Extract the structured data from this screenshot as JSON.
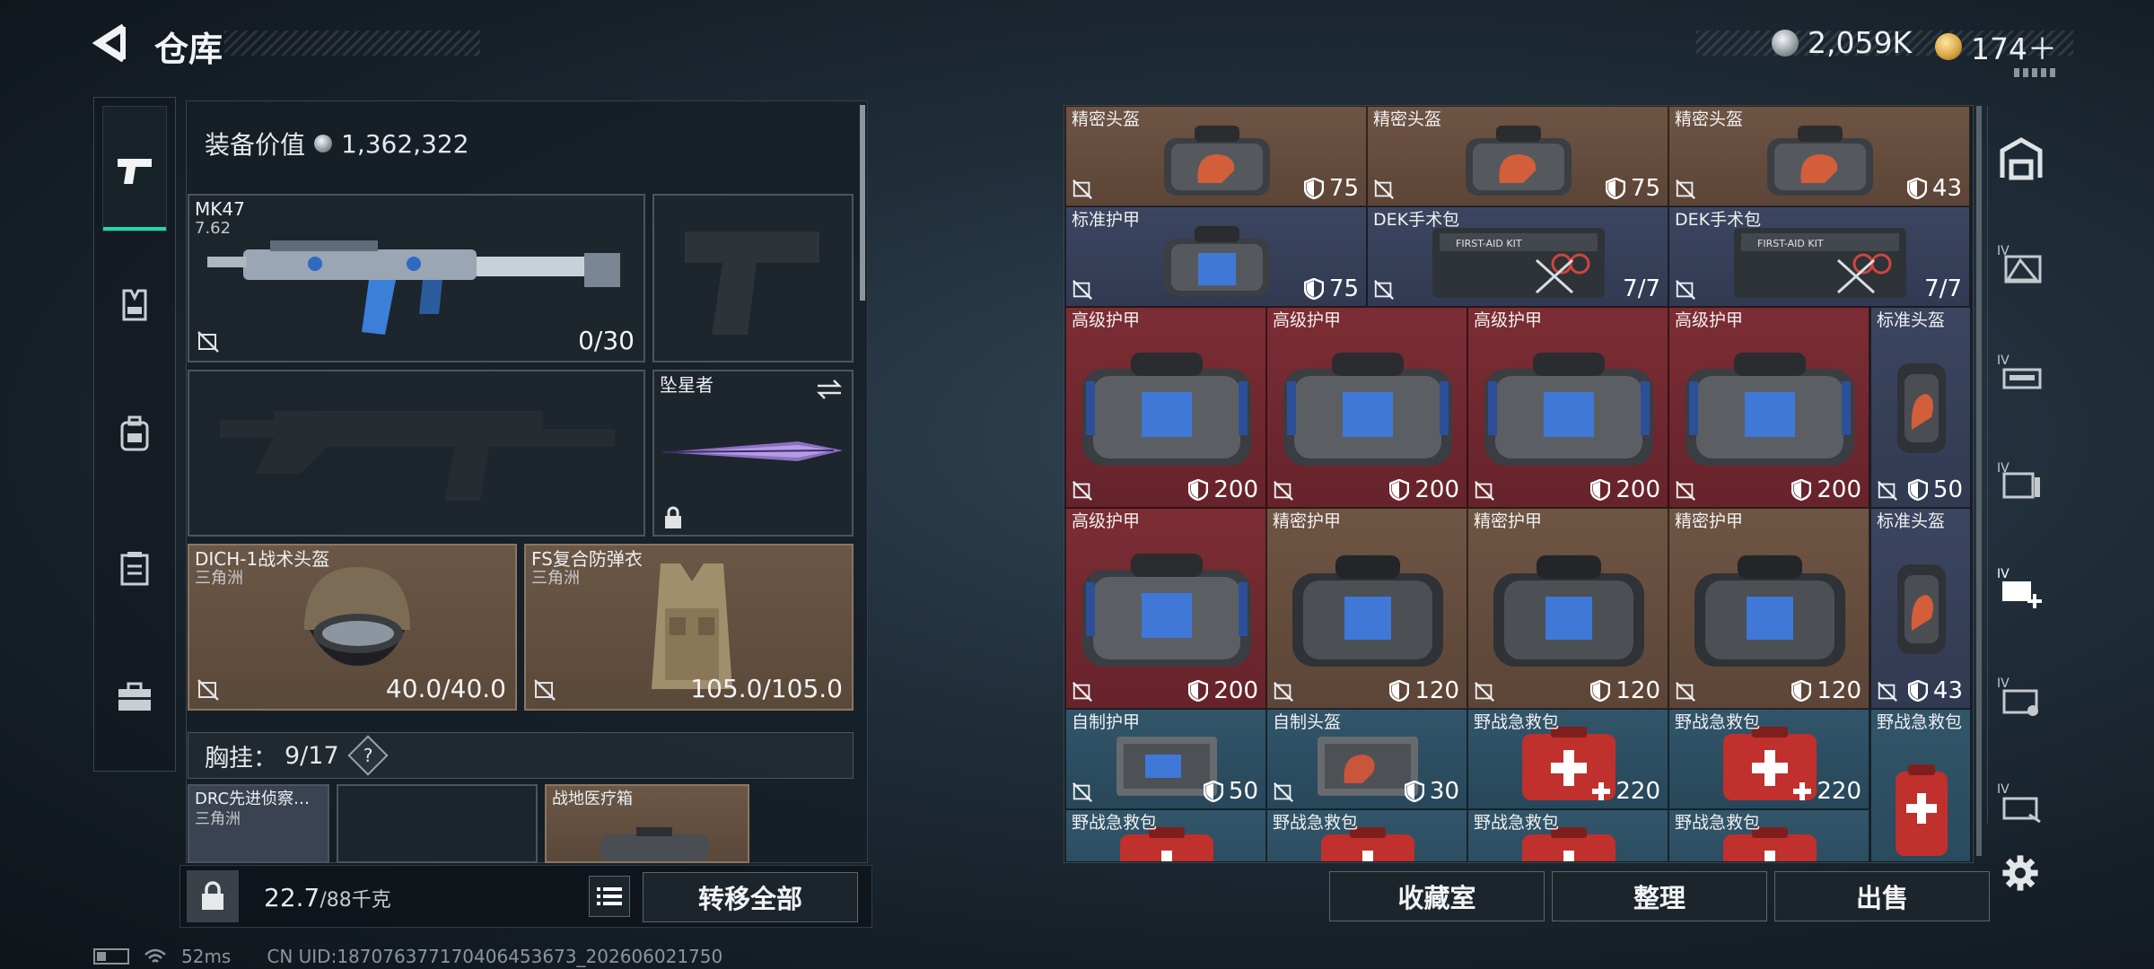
{
  "header": {
    "title": "仓库",
    "currency1": "2,059K",
    "currency2": "174＋"
  },
  "left": {
    "equip_value_label": "装备价值",
    "equip_value": "1,362,322",
    "weapon1": {
      "name": "MK47",
      "ammo_type": "7.62",
      "ammo": "0/30"
    },
    "melee": {
      "name": "坠星者"
    },
    "helmet": {
      "name": "DICH-1战术头盔",
      "origin": "三角洲",
      "durability": "40.0/40.0"
    },
    "armor": {
      "name": "FS复合防弹衣",
      "origin": "三角洲",
      "durability": "105.0/105.0"
    },
    "rig": {
      "label": "胸挂：",
      "capacity": "9/17",
      "help": "?"
    },
    "rig_items": [
      {
        "name": "DRC先进侦察…",
        "origin": "三角洲"
      },
      {
        "name": ""
      },
      {
        "name": "战地医疗箱"
      }
    ],
    "weight": "22.7",
    "weight_max": "/88千克",
    "transfer_all": "转移全部"
  },
  "grid": {
    "cells": [
      {
        "name": "精密头盔",
        "value": "75",
        "kind": "shield",
        "color": "brown"
      },
      {
        "name": "精密头盔",
        "value": "75",
        "kind": "shield",
        "color": "brown"
      },
      {
        "name": "精密头盔",
        "value": "43",
        "kind": "shield",
        "color": "brown"
      },
      {
        "name": "标准护甲",
        "value": "75",
        "kind": "shield",
        "color": "navy"
      },
      {
        "name": "DEK手术包",
        "value": "7/7",
        "kind": "count",
        "color": "navy"
      },
      {
        "name": "DEK手术包",
        "value": "7/7",
        "kind": "count",
        "color": "navy"
      },
      {
        "name": "高级护甲",
        "value": "200",
        "kind": "shield",
        "color": "red"
      },
      {
        "name": "高级护甲",
        "value": "200",
        "kind": "shield",
        "color": "red"
      },
      {
        "name": "高级护甲",
        "value": "200",
        "kind": "shield",
        "color": "red"
      },
      {
        "name": "高级护甲",
        "value": "200",
        "kind": "shield",
        "color": "red"
      },
      {
        "name": "标准头盔",
        "value": "50",
        "kind": "shield",
        "color": "navy"
      },
      {
        "name": "高级护甲",
        "value": "200",
        "kind": "shield",
        "color": "red"
      },
      {
        "name": "精密护甲",
        "value": "120",
        "kind": "shield",
        "color": "brown"
      },
      {
        "name": "精密护甲",
        "value": "120",
        "kind": "shield",
        "color": "brown"
      },
      {
        "name": "精密护甲",
        "value": "120",
        "kind": "shield",
        "color": "brown"
      },
      {
        "name": "标准头盔",
        "value": "43",
        "kind": "shield",
        "color": "navy"
      },
      {
        "name": "自制护甲",
        "value": "50",
        "kind": "shield",
        "color": "teal"
      },
      {
        "name": "自制头盔",
        "value": "30",
        "kind": "shield",
        "color": "teal"
      },
      {
        "name": "野战急救包",
        "value": "220",
        "kind": "heal",
        "color": "teal"
      },
      {
        "name": "野战急救包",
        "value": "220",
        "kind": "heal",
        "color": "teal"
      },
      {
        "name": "野战急救包",
        "value": "",
        "kind": "none",
        "color": "teal"
      },
      {
        "name": "野战急救包",
        "value": "",
        "kind": "none",
        "color": "teal"
      },
      {
        "name": "野战急救包",
        "value": "",
        "kind": "none",
        "color": "teal"
      },
      {
        "name": "野战急救包",
        "value": "",
        "kind": "none",
        "color": "teal"
      },
      {
        "name": "野战急救包",
        "value": "",
        "kind": "none",
        "color": "teal"
      }
    ]
  },
  "bottom_buttons": {
    "collection": "收藏室",
    "organize": "整理",
    "sell": "出售"
  },
  "status": {
    "ping": "52ms",
    "uid": "CN UID:18707637717040645367​3_202606021750"
  },
  "sidebar_icons": [
    "pistol-icon",
    "vest-icon",
    "backpack-icon",
    "rig-icon",
    "briefcase-icon"
  ],
  "right_icons": [
    "storage-icon",
    "storage-tab-1-icon",
    "storage-tab-2-icon",
    "storage-tab-3-icon",
    "storage-add-icon",
    "storage-tab-5-icon",
    "storage-tab-6-icon",
    "settings-icon"
  ],
  "colors": {
    "brown": "#6e5443",
    "navy": "#3c4560",
    "red": "#7c2d34",
    "teal": "#325569",
    "accent": "#1fd9a6"
  }
}
